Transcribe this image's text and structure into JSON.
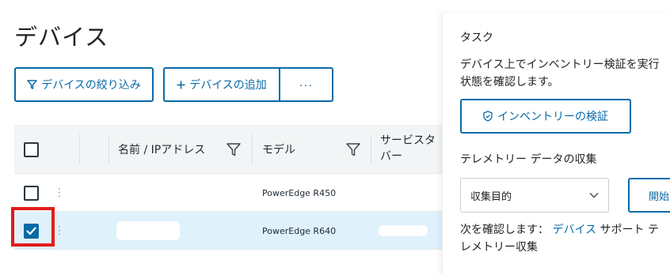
{
  "page_title": "デバイス",
  "toolbar": {
    "filter_label": "デバイスの絞り込み",
    "add_label": "デバイスの追加",
    "more_label": "···"
  },
  "table": {
    "columns": [
      "名前 / IPアドレス",
      "モデル",
      "サービスタ",
      "バー"
    ],
    "rows": [
      {
        "name": "",
        "model": "PowerEdge R450",
        "service_tag": "",
        "checked": false
      },
      {
        "name": "",
        "model": "PowerEdge R640",
        "service_tag": "",
        "checked": true
      }
    ]
  },
  "panel": {
    "title": "タスク",
    "desc_line1": "デバイス上でインベントリー検証を実行",
    "desc_line2": "状態を確認します。",
    "verify_label": "インベントリーの検証",
    "telemetry_title": "テレメトリー データの収集",
    "select_value": "収集目的",
    "start_label": "開始",
    "note_prefix": "次を確認します：",
    "note_link": "デバイス",
    "note_suffix": " サポート テレメトリー収集"
  },
  "colors": {
    "accent": "#0a6aa8",
    "selected_row": "#dff1fb",
    "highlight": "#e21b1b",
    "header_bg": "#f2f4f5"
  }
}
